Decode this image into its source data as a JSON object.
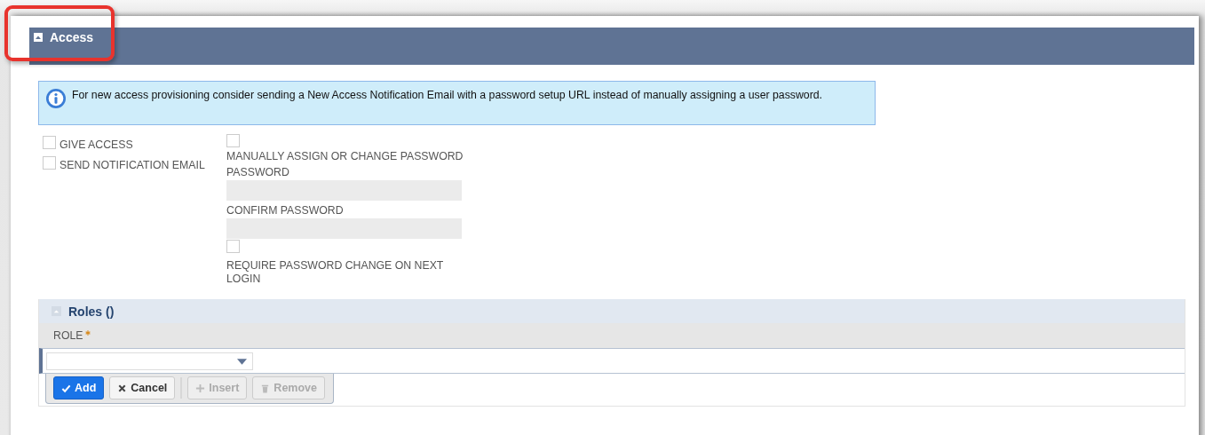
{
  "section": {
    "title": "Access",
    "expanded": true,
    "highlighted": true
  },
  "info": {
    "text": "For new access provisioning consider sending a New Access Notification Email with a password setup URL instead of manually assigning a user password."
  },
  "left_options": [
    {
      "label": "GIVE ACCESS",
      "checked": false
    },
    {
      "label": "SEND NOTIFICATION EMAIL",
      "checked": false
    }
  ],
  "manual_password": {
    "label": "MANUALLY ASSIGN OR CHANGE PASSWORD",
    "checked": false
  },
  "fields": [
    {
      "label": "PASSWORD",
      "disabled": true
    },
    {
      "label": "CONFIRM PASSWORD",
      "disabled": true
    }
  ],
  "require_change": {
    "label": "REQUIRE PASSWORD CHANGE ON NEXT LOGIN",
    "checked": false
  },
  "roles": {
    "title": "Roles ()",
    "expanded": true,
    "columns": [
      {
        "label": "ROLE",
        "required": true
      }
    ],
    "buttons": [
      {
        "label": "Add",
        "kind": "add",
        "disabled": false
      },
      {
        "label": "Cancel",
        "kind": "cancel",
        "disabled": false
      },
      {
        "label": "Insert",
        "kind": "insert",
        "disabled": true
      },
      {
        "label": "Remove",
        "kind": "remove",
        "disabled": true
      }
    ]
  }
}
